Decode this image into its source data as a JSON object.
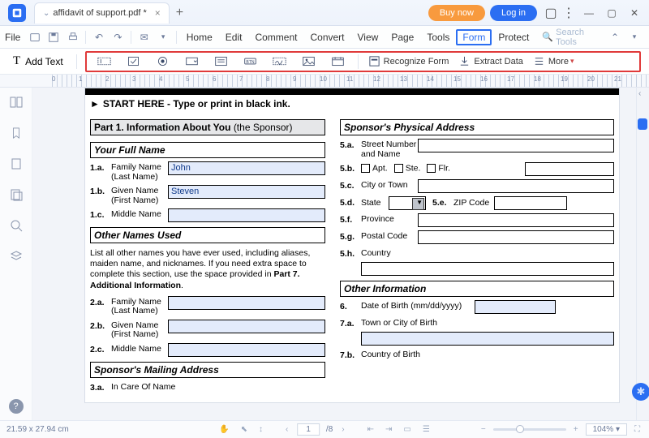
{
  "titlebar": {
    "tab_title": "affidavit of support.pdf *",
    "buy": "Buy now",
    "login": "Log in"
  },
  "menubar": {
    "file": "File",
    "items": [
      "Home",
      "Edit",
      "Comment",
      "Convert",
      "View",
      "Page",
      "Tools",
      "Form",
      "Protect"
    ],
    "active_index": 7,
    "search_placeholder": "Search Tools"
  },
  "formbar": {
    "add_text": "Add Text",
    "recognize": "Recognize Form",
    "extract": "Extract Data",
    "more": "More"
  },
  "ruler": {
    "labels": [
      "0",
      "1",
      "2",
      "3",
      "4",
      "5",
      "6",
      "7",
      "8",
      "9",
      "10",
      "11",
      "12",
      "13",
      "14",
      "15",
      "16",
      "17",
      "18",
      "19",
      "20",
      "21"
    ]
  },
  "doc": {
    "start_here": "START HERE - Type or print in black ink.",
    "part1": {
      "label": "Part 1.",
      "title": "Information About You",
      "suffix": "(the Sponsor)"
    },
    "your_full_name": "Your Full Name",
    "r1a": {
      "n": "1.a.",
      "l1": "Family Name",
      "l2": "(Last Name)",
      "v": "John"
    },
    "r1b": {
      "n": "1.b.",
      "l1": "Given Name",
      "l2": "(First Name)",
      "v": "Steven"
    },
    "r1c": {
      "n": "1.c.",
      "l": "Middle Name"
    },
    "other_names": "Other Names Used",
    "other_para_a": "List all other names you have ever used, including aliases, maiden name, and nicknames.  If you need extra space to complete this section, use the space provided in ",
    "other_para_b": "Part 7. Additional Information",
    "r2a": {
      "n": "2.a.",
      "l1": "Family Name",
      "l2": "(Last Name)"
    },
    "r2b": {
      "n": "2.b.",
      "l1": "Given Name",
      "l2": "(First Name)"
    },
    "r2c": {
      "n": "2.c.",
      "l": "Middle Name"
    },
    "mailing": "Sponsor's Mailing Address",
    "r3a": {
      "n": "3.a.",
      "l": "In Care Of Name"
    },
    "phys": "Sponsor's Physical Address",
    "r5a": {
      "n": "5.a.",
      "l1": "Street Number",
      "l2": "and Name"
    },
    "r5b": {
      "n": "5.b.",
      "apt": "Apt.",
      "ste": "Ste.",
      "flr": "Flr."
    },
    "r5c": {
      "n": "5.c.",
      "l": "City or Town"
    },
    "r5d": {
      "n": "5.d.",
      "l": "State"
    },
    "r5e": {
      "n": "5.e.",
      "l": "ZIP Code"
    },
    "r5f": {
      "n": "5.f.",
      "l": "Province"
    },
    "r5g": {
      "n": "5.g.",
      "l": "Postal Code"
    },
    "r5h": {
      "n": "5.h.",
      "l": "Country"
    },
    "other_info": "Other Information",
    "r6": {
      "n": "6.",
      "l": "Date of Birth (mm/dd/yyyy)"
    },
    "r7a": {
      "n": "7.a.",
      "l": "Town or City of Birth"
    },
    "r7b": {
      "n": "7.b.",
      "l": "Country of Birth"
    }
  },
  "status": {
    "dims": "21.59 x 27.94 cm",
    "page": "1",
    "pages": "/8",
    "zoom": "104%"
  }
}
